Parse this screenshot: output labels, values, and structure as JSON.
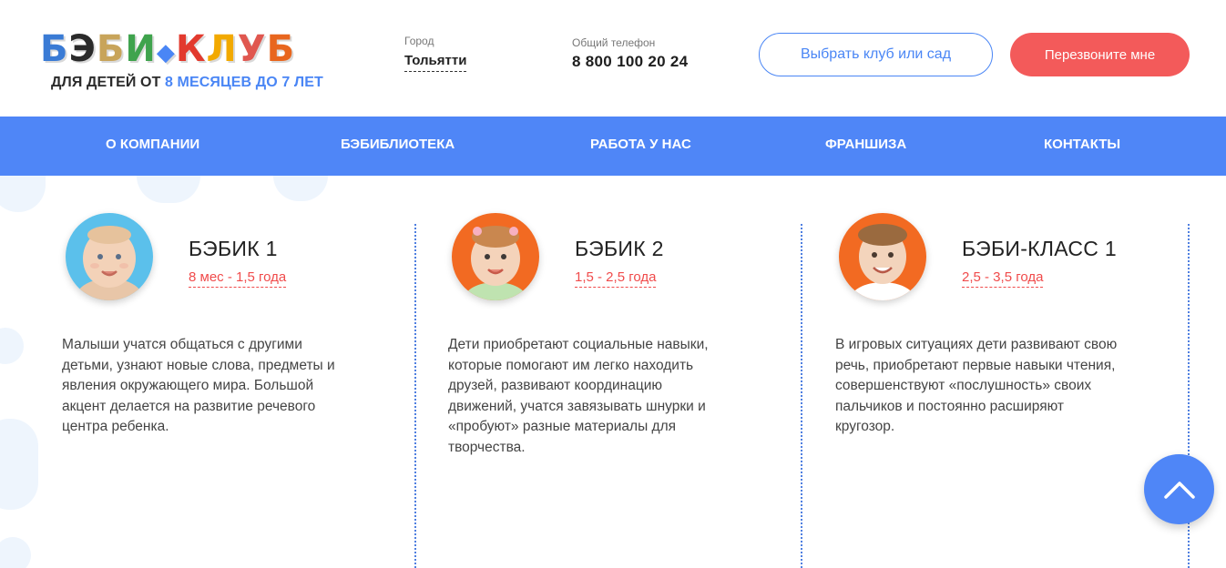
{
  "header": {
    "logo": {
      "text": "БЭБИ-КЛУБ",
      "tagline_prefix": "ДЛЯ ДЕТЕЙ ОТ ",
      "tagline_accent": "8 МЕСЯЦЕВ ДО 7 ЛЕТ"
    },
    "city": {
      "caption": "Город",
      "value": "Тольятти"
    },
    "phone": {
      "caption": "Общий телефон",
      "value": "8 800 100 20 24"
    },
    "choose_button": "Выбрать клуб или сад",
    "callback_button": "Перезвоните мне"
  },
  "nav": {
    "items": [
      {
        "label": "О КОМПАНИИ"
      },
      {
        "label": "БЭБИБЛИОТЕКА"
      },
      {
        "label": "РАБОТА У НАС"
      },
      {
        "label": "ФРАНШИЗА"
      },
      {
        "label": "КОНТАКТЫ"
      }
    ]
  },
  "cards": [
    {
      "title": "БЭБИК 1",
      "age": "8 мес - 1,5 года",
      "description": "Малыши учатся общаться с другими детьми, узнают новые слова, предметы и явления окружающего мира. Большой акцент делается на развитие речевого центра ребенка.",
      "avatar_color": "#5bc0eb"
    },
    {
      "title": "БЭБИК 2",
      "age": "1,5 - 2,5 года",
      "description": "Дети приобретают социальные навыки, которые помогают им легко находить друзей, развивают координацию движений, учатся завязывать шнурки и «пробуют» разные материалы для творчества.",
      "avatar_color": "#f26a22"
    },
    {
      "title": "БЭБИ-КЛАСС 1",
      "age": "2,5 - 3,5 года",
      "description": "В игровых ситуациях дети развивают свою речь, приобретают первые навыки чтения, совершенствуют «послушность» своих пальчиков и постоянно расширяют кругозор.",
      "avatar_color": "#f26a22"
    }
  ],
  "colors": {
    "brand_blue": "#4f86f7",
    "accent_red": "#f35a5a",
    "age_red": "#f04b4b"
  },
  "icons": {
    "scroll_top": "chevron-up-icon"
  }
}
